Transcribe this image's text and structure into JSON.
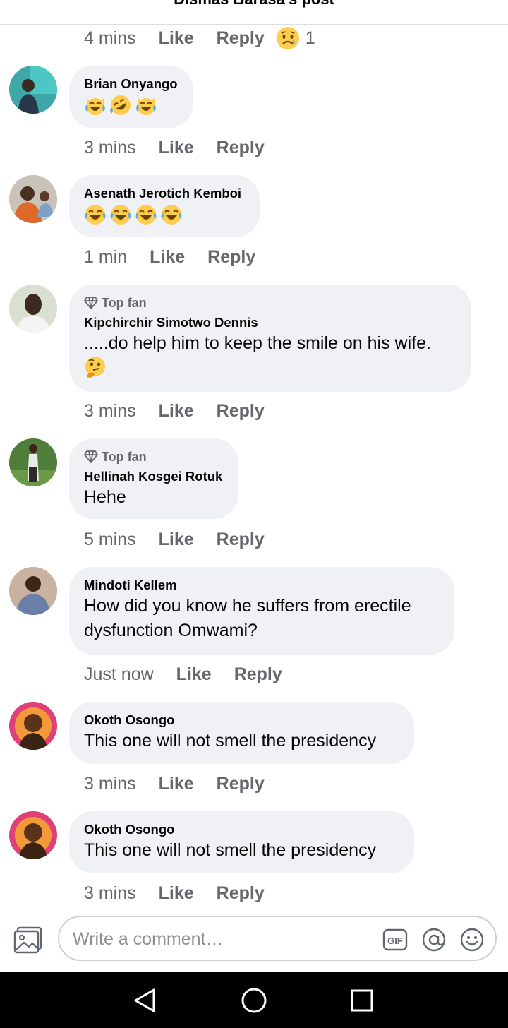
{
  "header": {
    "title": "Dismas Barasa's post"
  },
  "first_meta": {
    "time": "4 mins",
    "like": "Like",
    "reply": "Reply",
    "reaction_count": "1"
  },
  "comments": [
    {
      "author": "Brian Onyango",
      "top_fan": "",
      "text": "",
      "emojis": [
        "cat-tears-of-joy",
        "rolling-laughing",
        "cat-tears-of-joy"
      ],
      "time": "3 mins",
      "like": "Like",
      "reply": "Reply"
    },
    {
      "author": "Asenath Jerotich Kemboi",
      "top_fan": "",
      "text": "",
      "emojis": [
        "tears-of-joy",
        "tears-of-joy",
        "tears-of-joy",
        "tears-of-joy"
      ],
      "time": "1 min",
      "like": "Like",
      "reply": "Reply"
    },
    {
      "author": "Kipchirchir Simotwo Dennis",
      "top_fan": "Top fan",
      "text": ".....do help him to keep the smile on his wife.",
      "emojis": [
        "thinking-face"
      ],
      "time": "3 mins",
      "like": "Like",
      "reply": "Reply"
    },
    {
      "author": "Hellinah Kosgei Rotuk",
      "top_fan": "Top fan",
      "text": "Hehe",
      "emojis": [],
      "time": "5 mins",
      "like": "Like",
      "reply": "Reply"
    },
    {
      "author": "Mindoti Kellem",
      "top_fan": "",
      "text": "How did you know he suffers from erectile dysfunction Omwami?",
      "emojis": [],
      "time": "Just now",
      "like": "Like",
      "reply": "Reply"
    },
    {
      "author": "Okoth Osongo",
      "top_fan": "",
      "text": "This one will not smell the presidency",
      "emojis": [],
      "time": "3 mins",
      "like": "Like",
      "reply": "Reply"
    },
    {
      "author": "Okoth Osongo",
      "top_fan": "",
      "text": "This one will not smell the presidency",
      "emojis": [],
      "time": "3 mins",
      "like": "Like",
      "reply": "Reply"
    }
  ],
  "composer": {
    "placeholder": "Write a comment…",
    "icons": [
      "photo-icon",
      "gif-icon",
      "mention-icon",
      "emoji-icon"
    ]
  },
  "navbar": {
    "icons": [
      "back-icon",
      "home-icon",
      "recents-icon"
    ]
  },
  "colors": {
    "bubble": "#eff1f4",
    "meta_text": "#65676b",
    "navbar": "#000000",
    "emoji_yellow": "#ffcc4d"
  }
}
